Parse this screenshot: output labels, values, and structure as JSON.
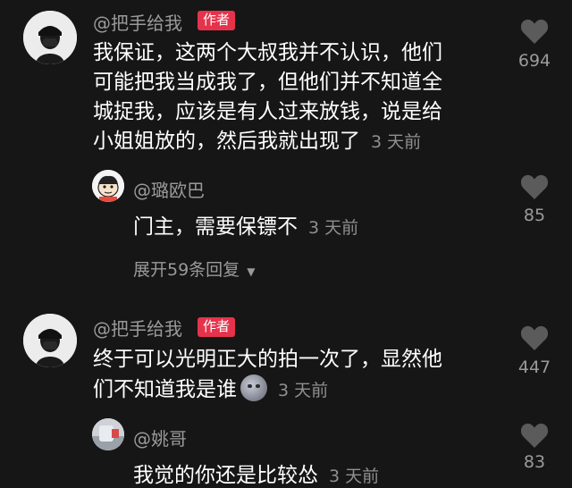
{
  "comments": [
    {
      "username": "@把手给我",
      "badge": "作者",
      "lines": [
        "我保证，这两个大叔我并不认识，他们",
        "可能把我当成我了，但他们并不知道全",
        "城捉我，应该是有人过来放钱，说是给",
        "小姐姐放的，然后我就出现了"
      ],
      "time": "3 天前",
      "likes": "694",
      "reply": {
        "username": "@璐欧巴",
        "text": "门主，需要保镖不",
        "time": "3 天前",
        "likes": "85"
      },
      "expand_label": "展开59条回复"
    },
    {
      "username": "@把手给我",
      "badge": "作者",
      "lines": [
        "终于可以光明正大的拍一次了，显然他",
        "们不知道我是谁"
      ],
      "emoji": "moon-face-emoji",
      "time": "3 天前",
      "likes": "447",
      "reply": {
        "username": "@姚哥",
        "text": "我觉的你还是比较怂",
        "time": "3 天前",
        "likes": "83"
      }
    }
  ],
  "icons": {
    "like": "heart-icon",
    "expand": "chevron-down-icon"
  },
  "colors": {
    "background": "#161616",
    "badge": "#e5334b",
    "secondary_text": "#9a9a9a"
  }
}
